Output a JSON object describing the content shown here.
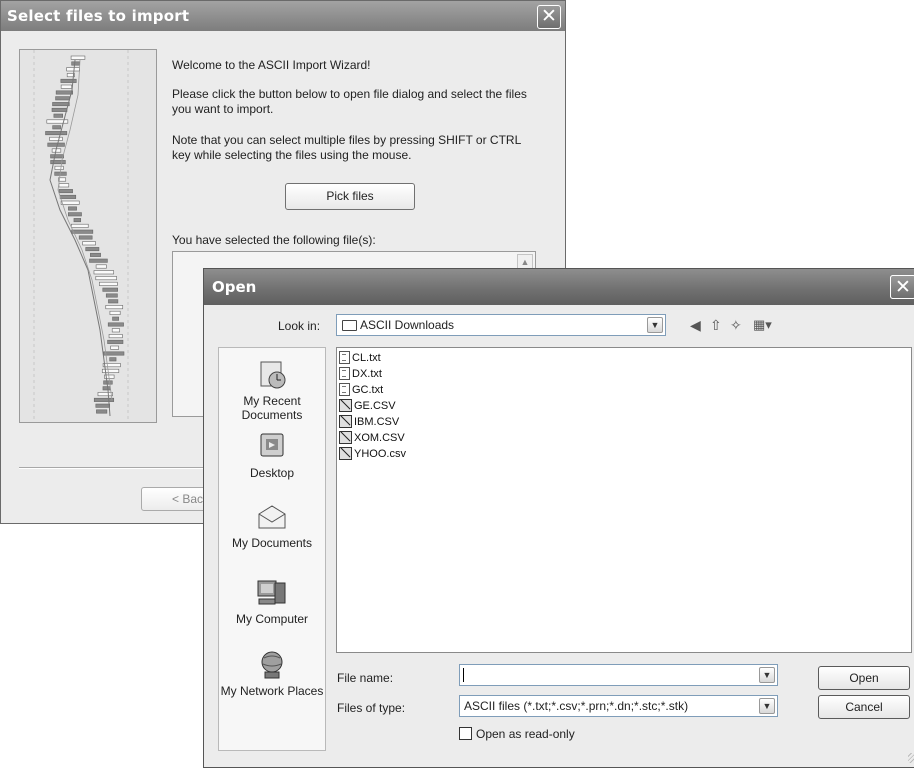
{
  "wizard": {
    "title": "Select files to import",
    "close_icon": "close-icon",
    "welcome": "Welcome to the ASCII Import Wizard!",
    "instructions": "Please click the button below to open file dialog and select the files you want to import.",
    "note": "Note that you can select multiple files by pressing SHIFT or CTRL key while selecting the files using the mouse.",
    "pick_button": "Pick files",
    "selected_label": "You have selected the following file(s):",
    "back_button": "< Back"
  },
  "open_dialog": {
    "title": "Open",
    "help_label": "?",
    "close_label": "X",
    "look_in_label": "Look in:",
    "look_in_value": "ASCII Downloads",
    "toolbar_icons": [
      "back-icon",
      "up-folder-icon",
      "new-folder-icon",
      "view-menu-icon"
    ],
    "places": [
      {
        "label": "My Recent Documents",
        "icon": "recent-documents-icon"
      },
      {
        "label": "Desktop",
        "icon": "desktop-icon"
      },
      {
        "label": "My Documents",
        "icon": "my-documents-icon"
      },
      {
        "label": "My Computer",
        "icon": "my-computer-icon"
      },
      {
        "label": "My Network Places",
        "icon": "network-places-icon"
      }
    ],
    "files": [
      {
        "name": "CL.txt",
        "type": "txt"
      },
      {
        "name": "DX.txt",
        "type": "txt"
      },
      {
        "name": "GC.txt",
        "type": "txt"
      },
      {
        "name": "GE.CSV",
        "type": "csv"
      },
      {
        "name": "IBM.CSV",
        "type": "csv"
      },
      {
        "name": "XOM.CSV",
        "type": "csv"
      },
      {
        "name": "YHOO.csv",
        "type": "csv"
      }
    ],
    "file_name_label": "File name:",
    "file_name_value": "",
    "files_of_type_label": "Files of type:",
    "files_of_type_value": "ASCII files (*.txt;*.csv;*.prn;*.dn;*.stc;*.stk)",
    "read_only_label": "Open as read-only",
    "read_only_checked": false,
    "open_button": "Open",
    "cancel_button": "Cancel"
  }
}
